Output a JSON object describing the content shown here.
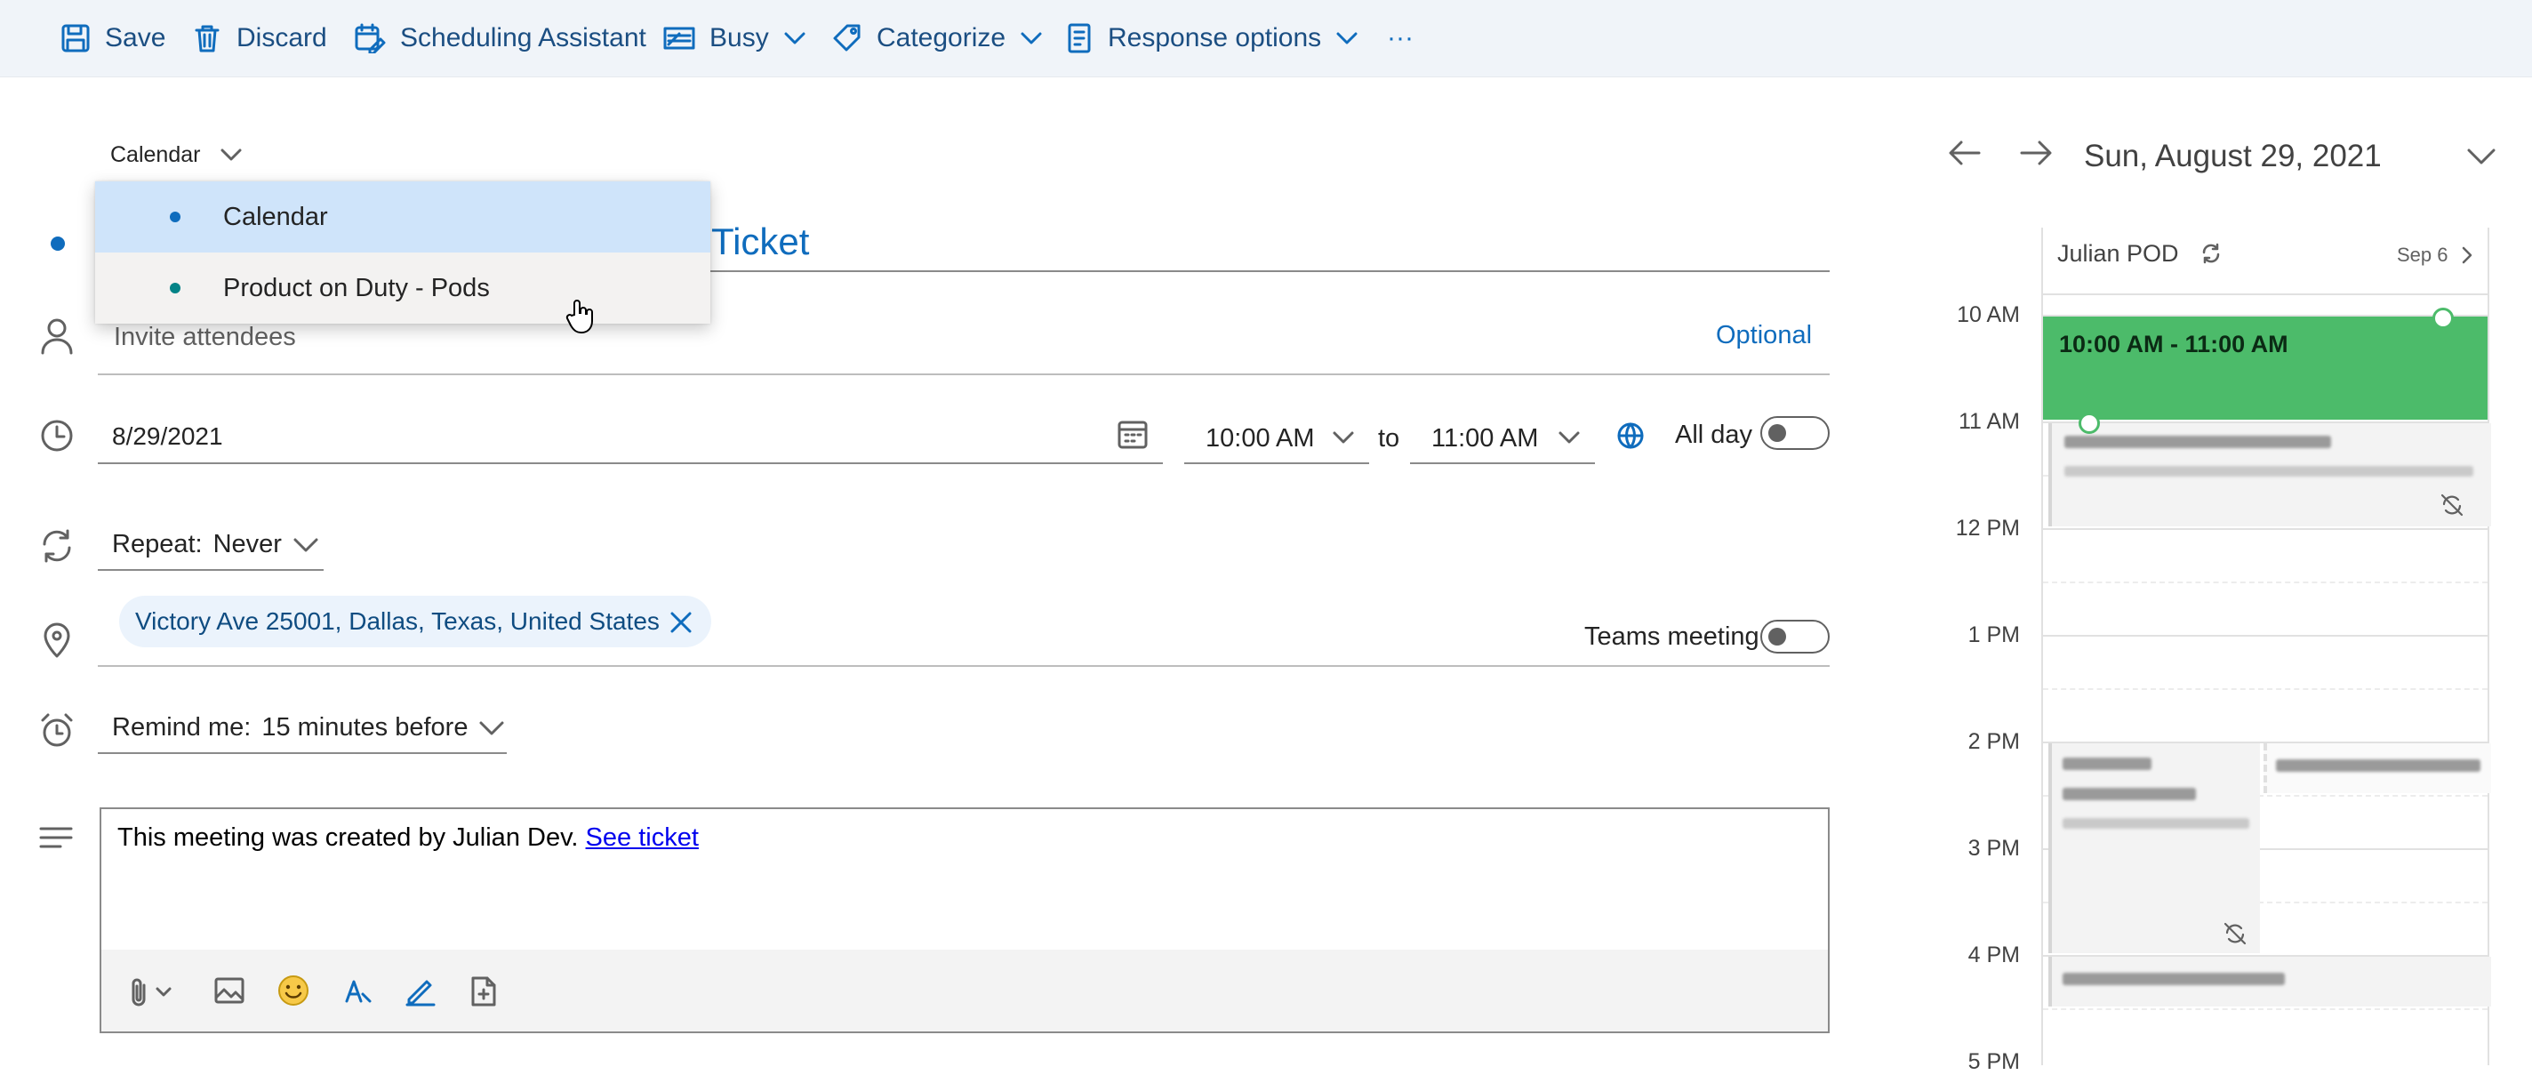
{
  "toolbar": {
    "save": "Save",
    "discard": "Discard",
    "scheduling": "Scheduling Assistant",
    "busy": "Busy",
    "categorize": "Categorize",
    "response": "Response options",
    "more": "···"
  },
  "calendar_select": {
    "label": "Calendar",
    "options": [
      {
        "label": "Calendar",
        "color": "#0f6cbd",
        "selected": true
      },
      {
        "label": "Product on Duty - Pods",
        "color": "#038387",
        "selected": false
      }
    ]
  },
  "event": {
    "title_visible_part": "Ticket",
    "attendees_placeholder": "Invite attendees",
    "optional_label": "Optional",
    "date": "8/29/2021",
    "start_time": "10:00 AM",
    "to_label": "to",
    "end_time": "11:00 AM",
    "all_day_label": "All day",
    "all_day": false,
    "repeat_label": "Repeat:",
    "repeat_value": "Never",
    "location": "Victory Ave 25001, Dallas, Texas, United States",
    "teams_label": "Teams meeting",
    "teams_enabled": false,
    "remind_label": "Remind me:",
    "remind_value": "15 minutes before",
    "body_text": "This meeting was created by Julian Dev.",
    "body_link": "See ticket"
  },
  "day_view": {
    "date_title": "Sun, August 29, 2021",
    "calendar_name": "Julian POD",
    "next_date": "Sep 6",
    "time_labels": [
      "10 AM",
      "11 AM",
      "12 PM",
      "1 PM",
      "2 PM",
      "3 PM",
      "4 PM",
      "5 PM"
    ],
    "new_event_time": "10:00 AM - 11:00 AM",
    "new_event_color": "#4cbb6a"
  },
  "colors": {
    "accent": "#0f6cbd",
    "toolbar_bg": "#f0f4f9",
    "dropdown_selected_bg": "#cfe4fa"
  }
}
